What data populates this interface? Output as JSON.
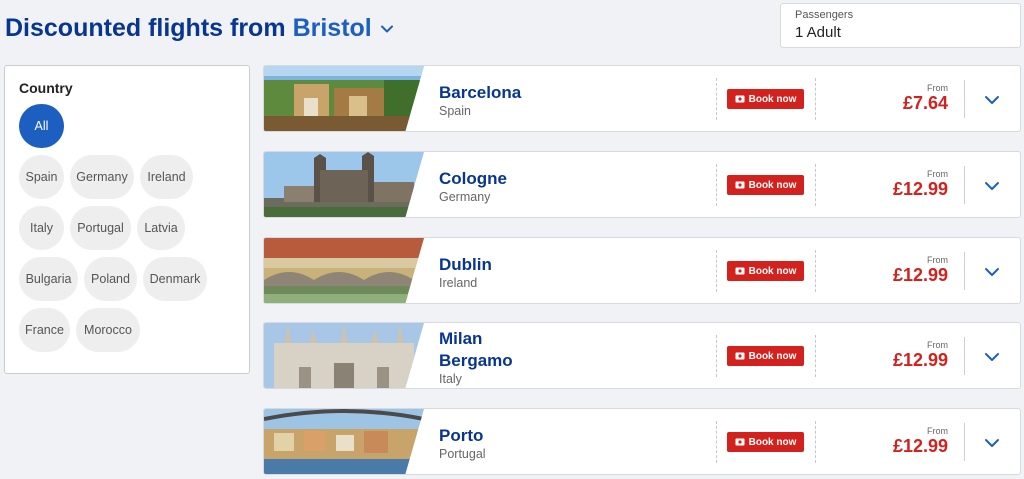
{
  "header": {
    "title_prefix": "Discounted flights from",
    "origin_city": "Bristol"
  },
  "passengers": {
    "label": "Passengers",
    "value": "1 Adult"
  },
  "filter": {
    "title": "Country",
    "chips": [
      "All",
      "Spain",
      "Germany",
      "Ireland",
      "Italy",
      "Portugal",
      "Latvia",
      "Bulgaria",
      "Poland",
      "Denmark",
      "France",
      "Morocco"
    ],
    "active": "All"
  },
  "flights": [
    {
      "city": "Barcelona",
      "country": "Spain",
      "book_label": "Book now",
      "from_label": "From",
      "price": "£7.64"
    },
    {
      "city": "Cologne",
      "country": "Germany",
      "book_label": "Book now",
      "from_label": "From",
      "price": "£12.99"
    },
    {
      "city": "Dublin",
      "country": "Ireland",
      "book_label": "Book now",
      "from_label": "From",
      "price": "£12.99"
    },
    {
      "city": "Milan Bergamo",
      "country": "Italy",
      "book_label": "Book now",
      "from_label": "From",
      "price": "£12.99"
    },
    {
      "city": "Porto",
      "country": "Portugal",
      "book_label": "Book now",
      "from_label": "From",
      "price": "£12.99"
    }
  ],
  "colors": {
    "brand_navy": "#073590",
    "brand_blue": "#1d5fc1",
    "price_red": "#d3211e"
  },
  "icons": {
    "origin_dropdown": "chevron-down-icon",
    "book_button": "ticket-icon",
    "expand": "chevron-down-icon"
  }
}
